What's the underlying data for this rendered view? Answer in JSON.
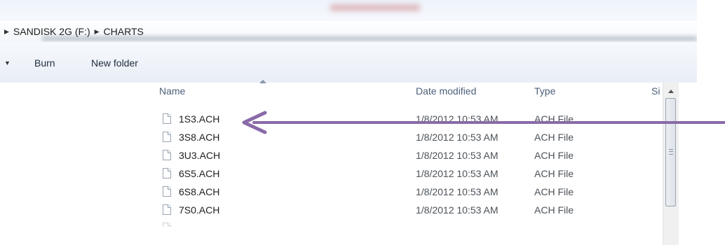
{
  "breadcrumb": {
    "items": [
      {
        "label": "SANDISK 2G (F:)"
      },
      {
        "label": "CHARTS"
      }
    ]
  },
  "toolbar": {
    "burn_label": "Burn",
    "new_folder_label": "New folder"
  },
  "columns": {
    "name": "Name",
    "date_modified": "Date modified",
    "type": "Type",
    "size": "Si"
  },
  "files": [
    {
      "name": "1S3.ACH",
      "date": "1/8/2012 10:53 AM",
      "type": "ACH File"
    },
    {
      "name": "3S8.ACH",
      "date": "1/8/2012 10:53 AM",
      "type": "ACH File"
    },
    {
      "name": "3U3.ACH",
      "date": "1/8/2012 10:53 AM",
      "type": "ACH File"
    },
    {
      "name": "6S5.ACH",
      "date": "1/8/2012 10:53 AM",
      "type": "ACH File"
    },
    {
      "name": "6S8.ACH",
      "date": "1/8/2012 10:53 AM",
      "type": "ACH File"
    },
    {
      "name": "7S0.ACH",
      "date": "1/8/2012 10:53 AM",
      "type": "ACH File"
    }
  ],
  "icons": {
    "file": "file-icon",
    "breadcrumb_separator": "chevron-right-icon",
    "sort": "sort-ascending-icon",
    "scroll_up": "scroll-up-icon",
    "annotation": "annotation-arrow-icon"
  },
  "colors": {
    "annotation_arrow": "#8a6aa8",
    "header_text": "#4c607a",
    "toolbar_bg": "#eef2f8"
  }
}
